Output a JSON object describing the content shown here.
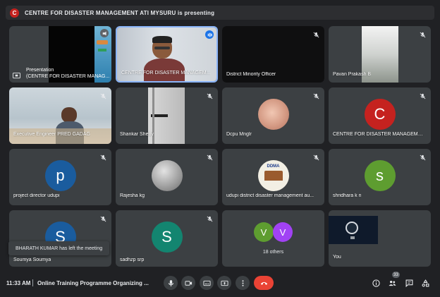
{
  "banner": {
    "avatar_letter": "C",
    "text": "CENTRE FOR DISASTER MANAGEMENT ATI MYSURU is presenting"
  },
  "tiles": [
    {
      "name": "Presentation",
      "name2": "(CENTRE FOR DISASTER MANAG..."
    },
    {
      "name": "CENTRE FOR DISASTER MANAGEM..."
    },
    {
      "name": "District Minority Officer"
    },
    {
      "name": "Pavan Prakash B"
    },
    {
      "name": "Executive Engineer PRED GADAG"
    },
    {
      "name": "Shankar Shetty"
    },
    {
      "name": "Dcpu Mnglr"
    },
    {
      "name": "CENTRE FOR DISASTER MANAGEMENT...",
      "avatar": "C"
    },
    {
      "name": "project director udupi",
      "avatar": "p"
    },
    {
      "name": "Rajesha kg"
    },
    {
      "name": "udupi district disaster management au...",
      "logo_text": "DDMA"
    },
    {
      "name": "shridhara k n",
      "avatar": "s"
    },
    {
      "name": "Soumya Soumya",
      "avatar": "S"
    },
    {
      "name": "sadhzp srp",
      "avatar": "S"
    },
    {
      "name": "18 others",
      "avatars": [
        "V",
        "V"
      ]
    },
    {
      "name": "You"
    }
  ],
  "toast": "BHARATH KUMAR has left the meeting",
  "bottom": {
    "time": "11:33 AM",
    "title": "Online Training Programme Organizing ...",
    "participant_count": "33"
  },
  "colors": {
    "background": "#202124",
    "tile": "#3c4043",
    "end_call": "#ea4335",
    "avatar_red": "#c5221f",
    "avatar_blue": "#1a5c9e",
    "avatar_green": "#5e9d30",
    "avatar_teal": "#138570",
    "avatar_purple": "#a142f4"
  },
  "icons": [
    "mic-off-icon",
    "mic-on-icon",
    "present-icon",
    "camera-icon",
    "captions-icon",
    "more-icon",
    "end-call-icon",
    "info-icon",
    "people-icon",
    "chat-icon",
    "activities-icon"
  ]
}
